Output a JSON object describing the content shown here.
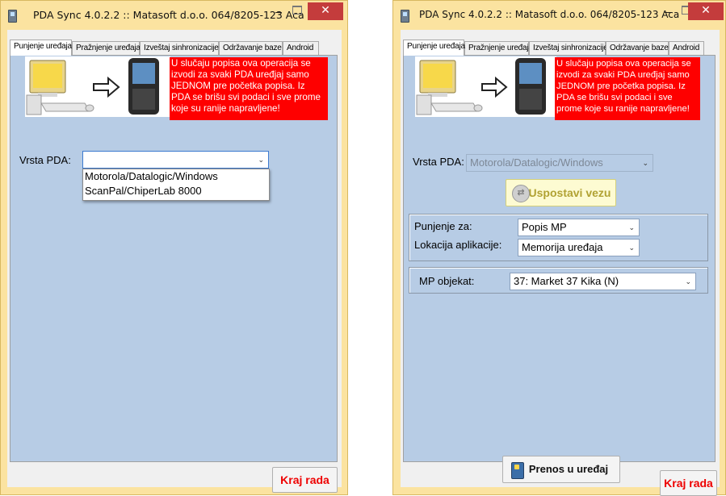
{
  "left_window": {
    "title": "PDA Sync 4.0.2.2 :: Matasoft d.o.o.  064/8205-123 Aca",
    "tabs": [
      "Punjenje uređaja",
      "Pražnjenje uređaja",
      "Izveštaj sinhronizacije",
      "Održavanje baze",
      "Android"
    ],
    "active_tab": "Punjenje uređaja",
    "warning": "U slučaju popisa ova operacija se izvodi za svaki PDA uređjaj samo JEDNOM pre početka popisa. Iz PDA se brišu svi podaci i sve prome koje su ranije napravljene!",
    "pda_label": "Vrsta PDA:",
    "pda_value": "",
    "dropdown_options": [
      "Motorola/Datalogic/Windows",
      "ScanPal/ChiperLab 8000"
    ],
    "exit_button": "Kraj rada"
  },
  "right_window": {
    "title": "PDA Sync 4.0.2.2 :: Matasoft d.o.o.  064/8205-123 Aca",
    "tabs": [
      "Punjenje uređaja",
      "Pražnjenje uređaja",
      "Izveštaj sinhronizacije",
      "Održavanje baze",
      "Android"
    ],
    "active_tab": "Punjenje uređaja",
    "warning": "U slučaju popisa ova operacija se izvodi za svaki PDA uređjaj samo JEDNOM pre početka popisa. Iz PDA se brišu svi podaci i sve prome koje su ranije napravljene!",
    "pda_label": "Vrsta PDA:",
    "pda_value": "Motorola/Datalogic/Windows",
    "connect_button": "Uspostavi vezu",
    "punjenje_label": "Punjenje za:",
    "punjenje_value": "Popis MP",
    "lokacija_label": "Lokacija aplikacije:",
    "lokacija_value": "Memorija uređaja",
    "mp_label": "MP objekat:",
    "mp_value": "37: Market 37 Kika (N)",
    "transfer_button": "Prenos u uređaj",
    "exit_button": "Kraj rada"
  },
  "colors": {
    "title_bar": "#fbe3a0",
    "panel_background": "#b7cce5",
    "warning_background": "#fe0000",
    "close_button": "#c43c3c",
    "exit_text": "#ee0000",
    "connect_button_text": "#b1a233"
  },
  "icons": [
    "app-icon",
    "minimize-icon",
    "maximize-icon",
    "close-icon",
    "computer-icon",
    "arrow-right-icon",
    "pda-device-icon",
    "chevron-down-icon",
    "connect-icon",
    "transfer-icon"
  ]
}
